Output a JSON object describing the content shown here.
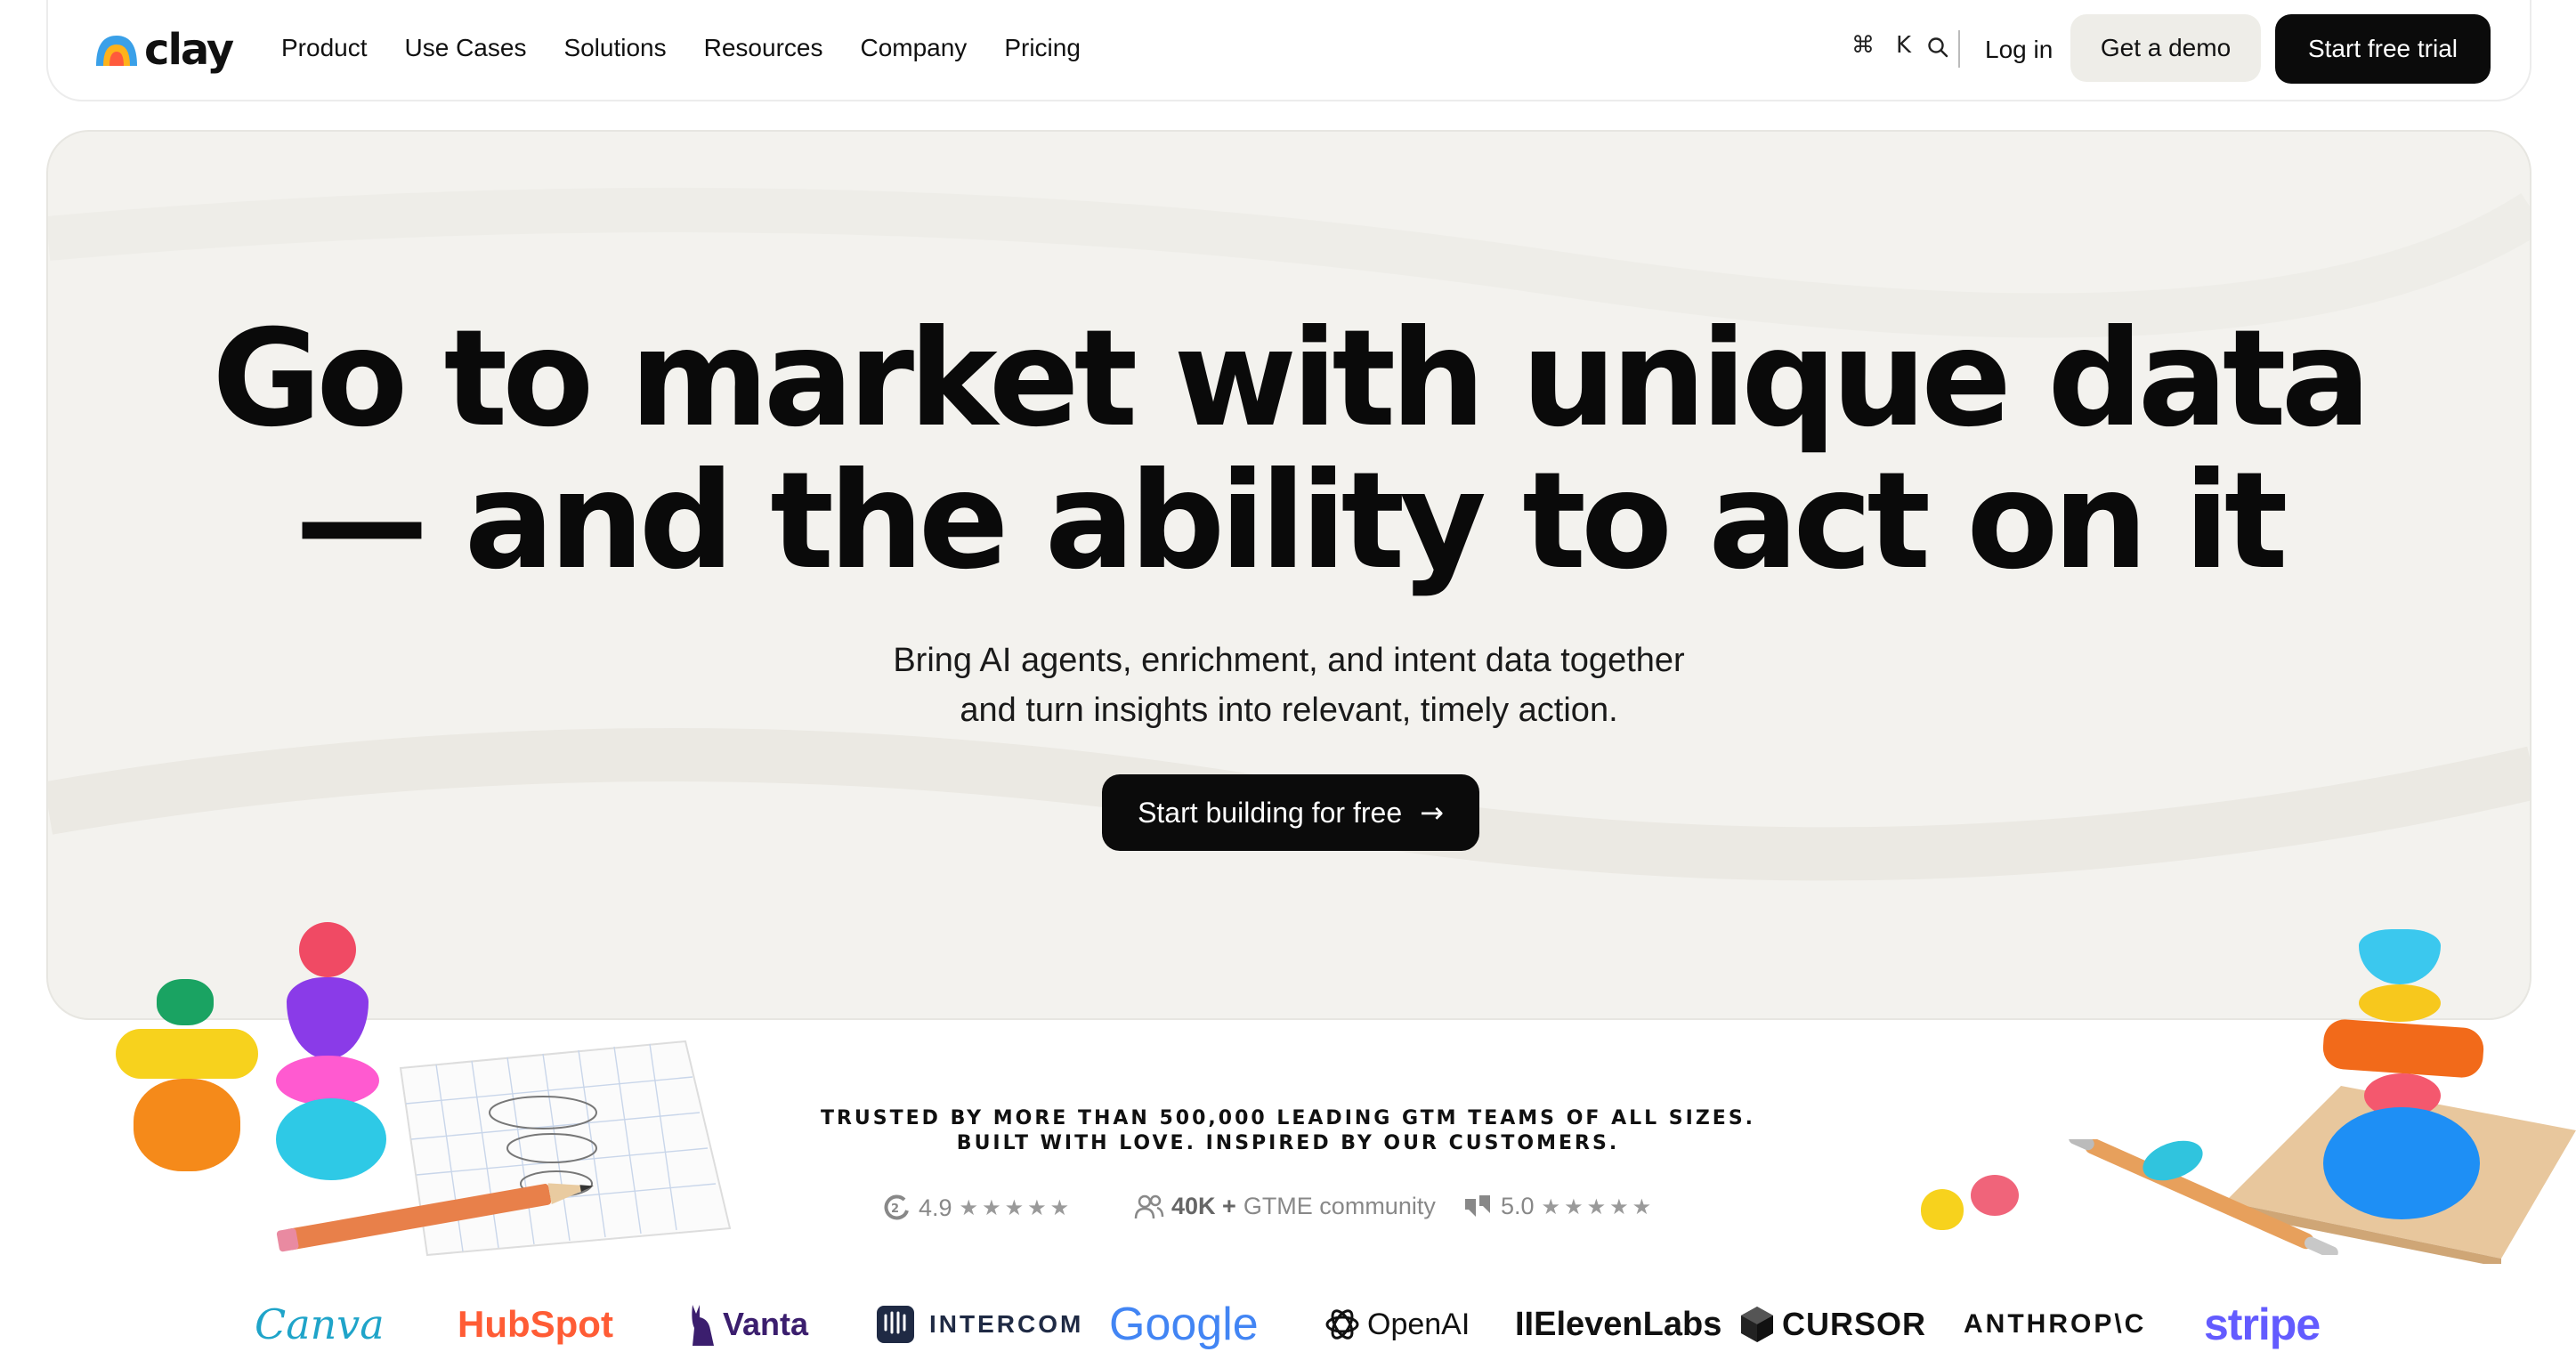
{
  "nav": {
    "logo_text": "clay",
    "menu": [
      "Product",
      "Use Cases",
      "Solutions",
      "Resources",
      "Company",
      "Pricing"
    ],
    "shortcut_cmd": "⌘",
    "shortcut_key": "K",
    "login_label": "Log in",
    "demo_label": "Get a demo",
    "trial_label": "Start free trial"
  },
  "hero": {
    "headline_line1": "Go to market with unique data",
    "headline_line2": "— and the ability to act on it",
    "sub_line1": "Bring AI agents, enrichment, and intent data together",
    "sub_line2": "and turn insights into relevant, timely action.",
    "cta_label": "Start building for free"
  },
  "trust": {
    "line1": "TRUSTED BY MORE THAN 500,000 LEADING GTM TEAMS OF ALL SIZES.",
    "line2": "BUILT WITH LOVE. INSPIRED BY OUR CUSTOMERS.",
    "g2_rating": "4.9",
    "community_count": "40K +",
    "community_label": "GTME community",
    "review_rating": "5.0",
    "stars": "★★★★★"
  },
  "logos": [
    "Canva",
    "HubSpot",
    "Vanta",
    "INTERCOM",
    "Google",
    "OpenAI",
    "IIElevenLabs",
    "CURSOR",
    "ANTHROP\\C",
    "stripe"
  ],
  "colors": {
    "hero_bg": "#f3f2ee",
    "primary_button": "#0b0b0b",
    "secondary_button": "#eeede8",
    "canva": "#1fa4c9",
    "hubspot": "#ff5c35",
    "vanta": "#3b1e6e",
    "intercom": "#1f2a44",
    "stripe": "#635bff"
  }
}
